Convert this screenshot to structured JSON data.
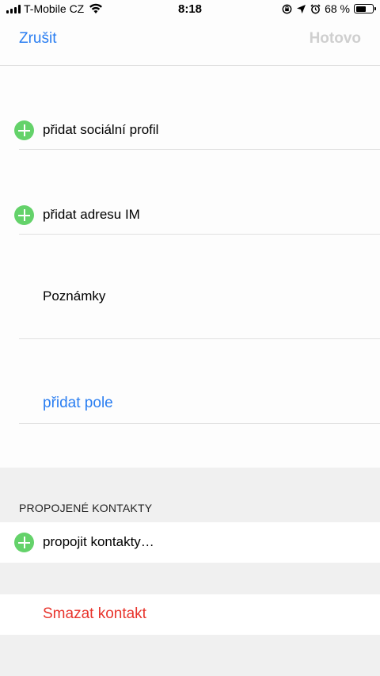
{
  "status_bar": {
    "carrier": "T-Mobile CZ",
    "time": "8:18",
    "battery_percent": "68 %",
    "battery_level": 0.68,
    "icons": [
      "signal-icon",
      "wifi-icon",
      "rotation-lock-icon",
      "location-icon",
      "alarm-icon",
      "battery-icon"
    ]
  },
  "nav": {
    "cancel_label": "Zrušit",
    "done_label": "Hotovo"
  },
  "fields": {
    "social_profile_label": "přidat sociální profil",
    "im_address_label": "přidat adresu IM",
    "notes_label": "Poznámky",
    "add_field_label": "přidat pole"
  },
  "linked_contacts": {
    "header": "PROPOJENÉ KONTAKTY",
    "link_label": "propojit kontakty…"
  },
  "delete": {
    "label": "Smazat kontakt"
  },
  "colors": {
    "accent_blue": "#2a7ef1",
    "add_green": "#64d26a",
    "destructive_red": "#e8342c",
    "disabled_gray": "#cfcfcf"
  }
}
